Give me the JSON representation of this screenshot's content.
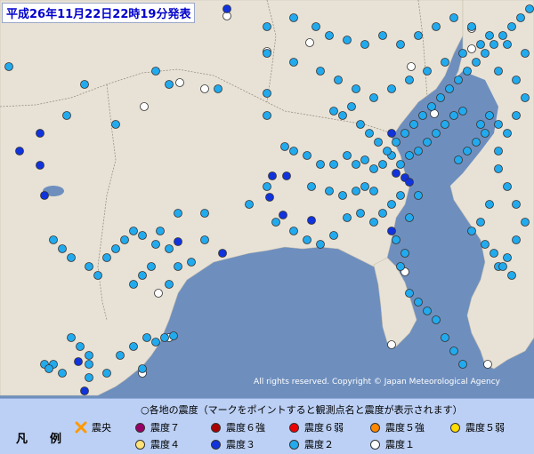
{
  "title": "平成26年11月22日22時19分発表",
  "copyright": "All rights reserved. Copyright © Japan Meteorological Agency",
  "legend": {
    "heading": "凡　例",
    "header": "○各地の震度（マークをポイントすると観測点名と震度が表示されます）",
    "items": [
      {
        "label": "震央",
        "color": "#ff9900",
        "kind": "epicenter"
      },
      {
        "label": "震度７",
        "color": "#990066"
      },
      {
        "label": "震度６強",
        "color": "#aa0000"
      },
      {
        "label": "震度６弱",
        "color": "#ee0000"
      },
      {
        "label": "震度５強",
        "color": "#ff8800"
      },
      {
        "label": "震度５弱",
        "color": "#ffdd00"
      },
      {
        "label": "震度４",
        "color": "#ffe27a"
      },
      {
        "label": "震度３",
        "color": "#1133dd"
      },
      {
        "label": "震度２",
        "color": "#22aaee"
      },
      {
        "label": "震度１",
        "color": "#ffffff"
      }
    ]
  },
  "map": {
    "land_color": "#e8e2d6",
    "sea_color": "#6e8fbe",
    "stations": {
      "intensity_3": [
        [
          306,
          198
        ],
        [
          322,
          198
        ],
        [
          45,
          150
        ],
        [
          50,
          220
        ],
        [
          22,
          170
        ],
        [
          45,
          186
        ],
        [
          318,
          242
        ],
        [
          350,
          248
        ],
        [
          440,
          150
        ],
        [
          445,
          195
        ],
        [
          455,
          200
        ],
        [
          303,
          222
        ],
        [
          200,
          272
        ],
        [
          250,
          285
        ],
        [
          88,
          407
        ],
        [
          255,
          10
        ],
        [
          460,
          205
        ],
        [
          440,
          260
        ],
        [
          95,
          440
        ]
      ],
      "intensity_2": [
        [
          10,
          75
        ],
        [
          75,
          130
        ],
        [
          95,
          95
        ],
        [
          130,
          140
        ],
        [
          175,
          80
        ],
        [
          190,
          95
        ],
        [
          245,
          100
        ],
        [
          300,
          105
        ],
        [
          300,
          130
        ],
        [
          320,
          165
        ],
        [
          330,
          170
        ],
        [
          345,
          175
        ],
        [
          360,
          185
        ],
        [
          375,
          185
        ],
        [
          390,
          175
        ],
        [
          400,
          185
        ],
        [
          410,
          180
        ],
        [
          420,
          190
        ],
        [
          430,
          185
        ],
        [
          440,
          175
        ],
        [
          450,
          185
        ],
        [
          460,
          175
        ],
        [
          470,
          170
        ],
        [
          480,
          160
        ],
        [
          490,
          150
        ],
        [
          500,
          140
        ],
        [
          510,
          130
        ],
        [
          520,
          125
        ],
        [
          300,
          30
        ],
        [
          330,
          20
        ],
        [
          355,
          30
        ],
        [
          370,
          40
        ],
        [
          390,
          45
        ],
        [
          410,
          50
        ],
        [
          430,
          40
        ],
        [
          450,
          50
        ],
        [
          470,
          40
        ],
        [
          490,
          30
        ],
        [
          510,
          20
        ],
        [
          530,
          30
        ],
        [
          550,
          40
        ],
        [
          570,
          50
        ],
        [
          590,
          60
        ],
        [
          300,
          60
        ],
        [
          330,
          70
        ],
        [
          360,
          80
        ],
        [
          380,
          90
        ],
        [
          400,
          100
        ],
        [
          420,
          110
        ],
        [
          440,
          100
        ],
        [
          460,
          90
        ],
        [
          480,
          80
        ],
        [
          500,
          70
        ],
        [
          520,
          60
        ],
        [
          540,
          50
        ],
        [
          560,
          80
        ],
        [
          580,
          90
        ],
        [
          310,
          250
        ],
        [
          330,
          260
        ],
        [
          345,
          270
        ],
        [
          360,
          275
        ],
        [
          375,
          265
        ],
        [
          390,
          245
        ],
        [
          405,
          240
        ],
        [
          420,
          250
        ],
        [
          430,
          240
        ],
        [
          440,
          230
        ],
        [
          450,
          220
        ],
        [
          460,
          245
        ],
        [
          470,
          220
        ],
        [
          350,
          210
        ],
        [
          370,
          215
        ],
        [
          385,
          220
        ],
        [
          400,
          215
        ],
        [
          410,
          210
        ],
        [
          420,
          215
        ],
        [
          280,
          230
        ],
        [
          300,
          210
        ],
        [
          200,
          240
        ],
        [
          230,
          240
        ],
        [
          180,
          260
        ],
        [
          160,
          265
        ],
        [
          175,
          275
        ],
        [
          190,
          280
        ],
        [
          170,
          300
        ],
        [
          160,
          310
        ],
        [
          150,
          320
        ],
        [
          190,
          320
        ],
        [
          200,
          300
        ],
        [
          215,
          295
        ],
        [
          230,
          270
        ],
        [
          60,
          270
        ],
        [
          70,
          280
        ],
        [
          80,
          290
        ],
        [
          100,
          300
        ],
        [
          110,
          310
        ],
        [
          120,
          290
        ],
        [
          130,
          280
        ],
        [
          140,
          270
        ],
        [
          150,
          260
        ],
        [
          80,
          380
        ],
        [
          90,
          390
        ],
        [
          100,
          400
        ],
        [
          60,
          410
        ],
        [
          70,
          420
        ],
        [
          100,
          425
        ],
        [
          120,
          420
        ],
        [
          135,
          400
        ],
        [
          150,
          390
        ],
        [
          165,
          380
        ],
        [
          175,
          385
        ],
        [
          185,
          380
        ],
        [
          195,
          378
        ],
        [
          160,
          415
        ],
        [
          100,
          410
        ],
        [
          50,
          410
        ],
        [
          55,
          415
        ],
        [
          460,
          330
        ],
        [
          470,
          340
        ],
        [
          480,
          350
        ],
        [
          490,
          360
        ],
        [
          500,
          380
        ],
        [
          510,
          395
        ],
        [
          520,
          410
        ],
        [
          560,
          300
        ],
        [
          570,
          290
        ],
        [
          580,
          270
        ],
        [
          590,
          250
        ],
        [
          580,
          230
        ],
        [
          570,
          210
        ],
        [
          560,
          190
        ],
        [
          560,
          170
        ],
        [
          570,
          150
        ],
        [
          580,
          130
        ],
        [
          590,
          110
        ],
        [
          560,
          140
        ],
        [
          550,
          230
        ],
        [
          540,
          250
        ],
        [
          530,
          260
        ],
        [
          545,
          275
        ],
        [
          555,
          285
        ],
        [
          565,
          300
        ],
        [
          575,
          310
        ],
        [
          450,
          300
        ],
        [
          455,
          285
        ],
        [
          445,
          270
        ],
        [
          540,
          140
        ],
        [
          550,
          130
        ],
        [
          515,
          180
        ],
        [
          525,
          170
        ],
        [
          535,
          160
        ],
        [
          545,
          150
        ],
        [
          375,
          125
        ],
        [
          385,
          130
        ],
        [
          395,
          120
        ],
        [
          405,
          140
        ],
        [
          415,
          150
        ],
        [
          425,
          160
        ],
        [
          435,
          170
        ],
        [
          445,
          160
        ],
        [
          455,
          150
        ],
        [
          465,
          140
        ],
        [
          475,
          130
        ],
        [
          485,
          120
        ],
        [
          495,
          110
        ],
        [
          505,
          100
        ],
        [
          515,
          90
        ],
        [
          525,
          80
        ],
        [
          535,
          70
        ],
        [
          545,
          60
        ],
        [
          555,
          50
        ],
        [
          565,
          40
        ],
        [
          575,
          30
        ],
        [
          585,
          20
        ],
        [
          595,
          10
        ]
      ],
      "intensity_1": [
        [
          202,
          93
        ],
        [
          230,
          100
        ],
        [
          162,
          120
        ],
        [
          348,
          48
        ],
        [
          300,
          58
        ],
        [
          462,
          75
        ],
        [
          488,
          128
        ],
        [
          530,
          32
        ],
        [
          530,
          55
        ],
        [
          255,
          18
        ],
        [
          455,
          306
        ],
        [
          440,
          388
        ],
        [
          548,
          410
        ],
        [
          178,
          330
        ],
        [
          190,
          380
        ],
        [
          160,
          420
        ]
      ]
    }
  }
}
